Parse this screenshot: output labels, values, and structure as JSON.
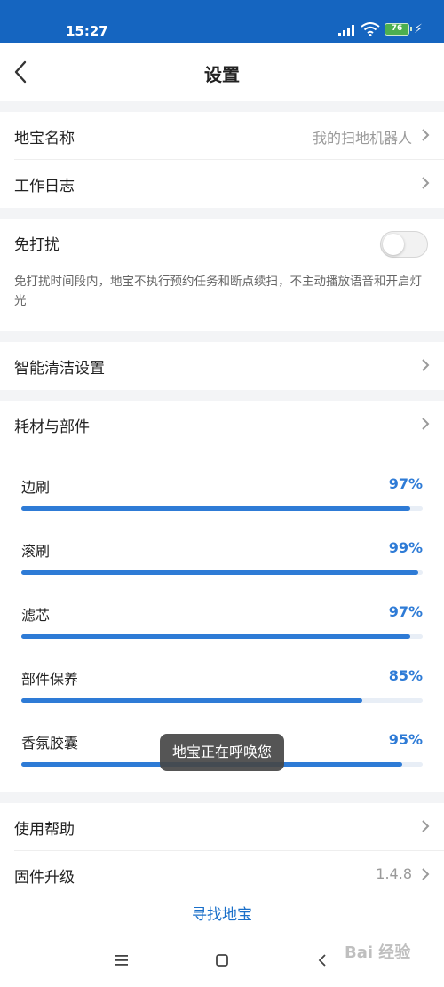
{
  "status_bar": {
    "time": "15:27",
    "battery": "76",
    "signal_icon": "signal-icon",
    "wifi_icon": "wifi-icon",
    "charging_icon": "charging-icon"
  },
  "header": {
    "title": "设置",
    "back_icon": "back-arrow-icon"
  },
  "settings": {
    "name_label": "地宝名称",
    "name_value": "我的扫地机器人",
    "log_label": "工作日志",
    "dnd_label": "免打扰",
    "dnd_on": false,
    "dnd_desc": "免打扰时间段内，地宝不执行预约任务和断点续扫，不主动播放语音和开启灯光",
    "smart_label": "智能清洁设置",
    "consumables_label": "耗材与部件"
  },
  "parts": [
    {
      "name": "边刷",
      "percent_text": "97%",
      "percent": 97
    },
    {
      "name": "滚刷",
      "percent_text": "99%",
      "percent": 99
    },
    {
      "name": "滤芯",
      "percent_text": "97%",
      "percent": 97
    },
    {
      "name": "部件保养",
      "percent_text": "85%",
      "percent": 85
    },
    {
      "name": "香氛胶囊",
      "percent_text": "95%",
      "percent": 95
    }
  ],
  "toast": "地宝正在呼唤您",
  "bottom": {
    "help_label": "使用帮助",
    "firmware_label": "固件升级",
    "firmware_value": "1.4.8",
    "find_label": "寻找地宝"
  },
  "watermark": "Bai 经验",
  "colors": {
    "accent": "#2e7bd6",
    "status_bar": "#1565c0"
  }
}
